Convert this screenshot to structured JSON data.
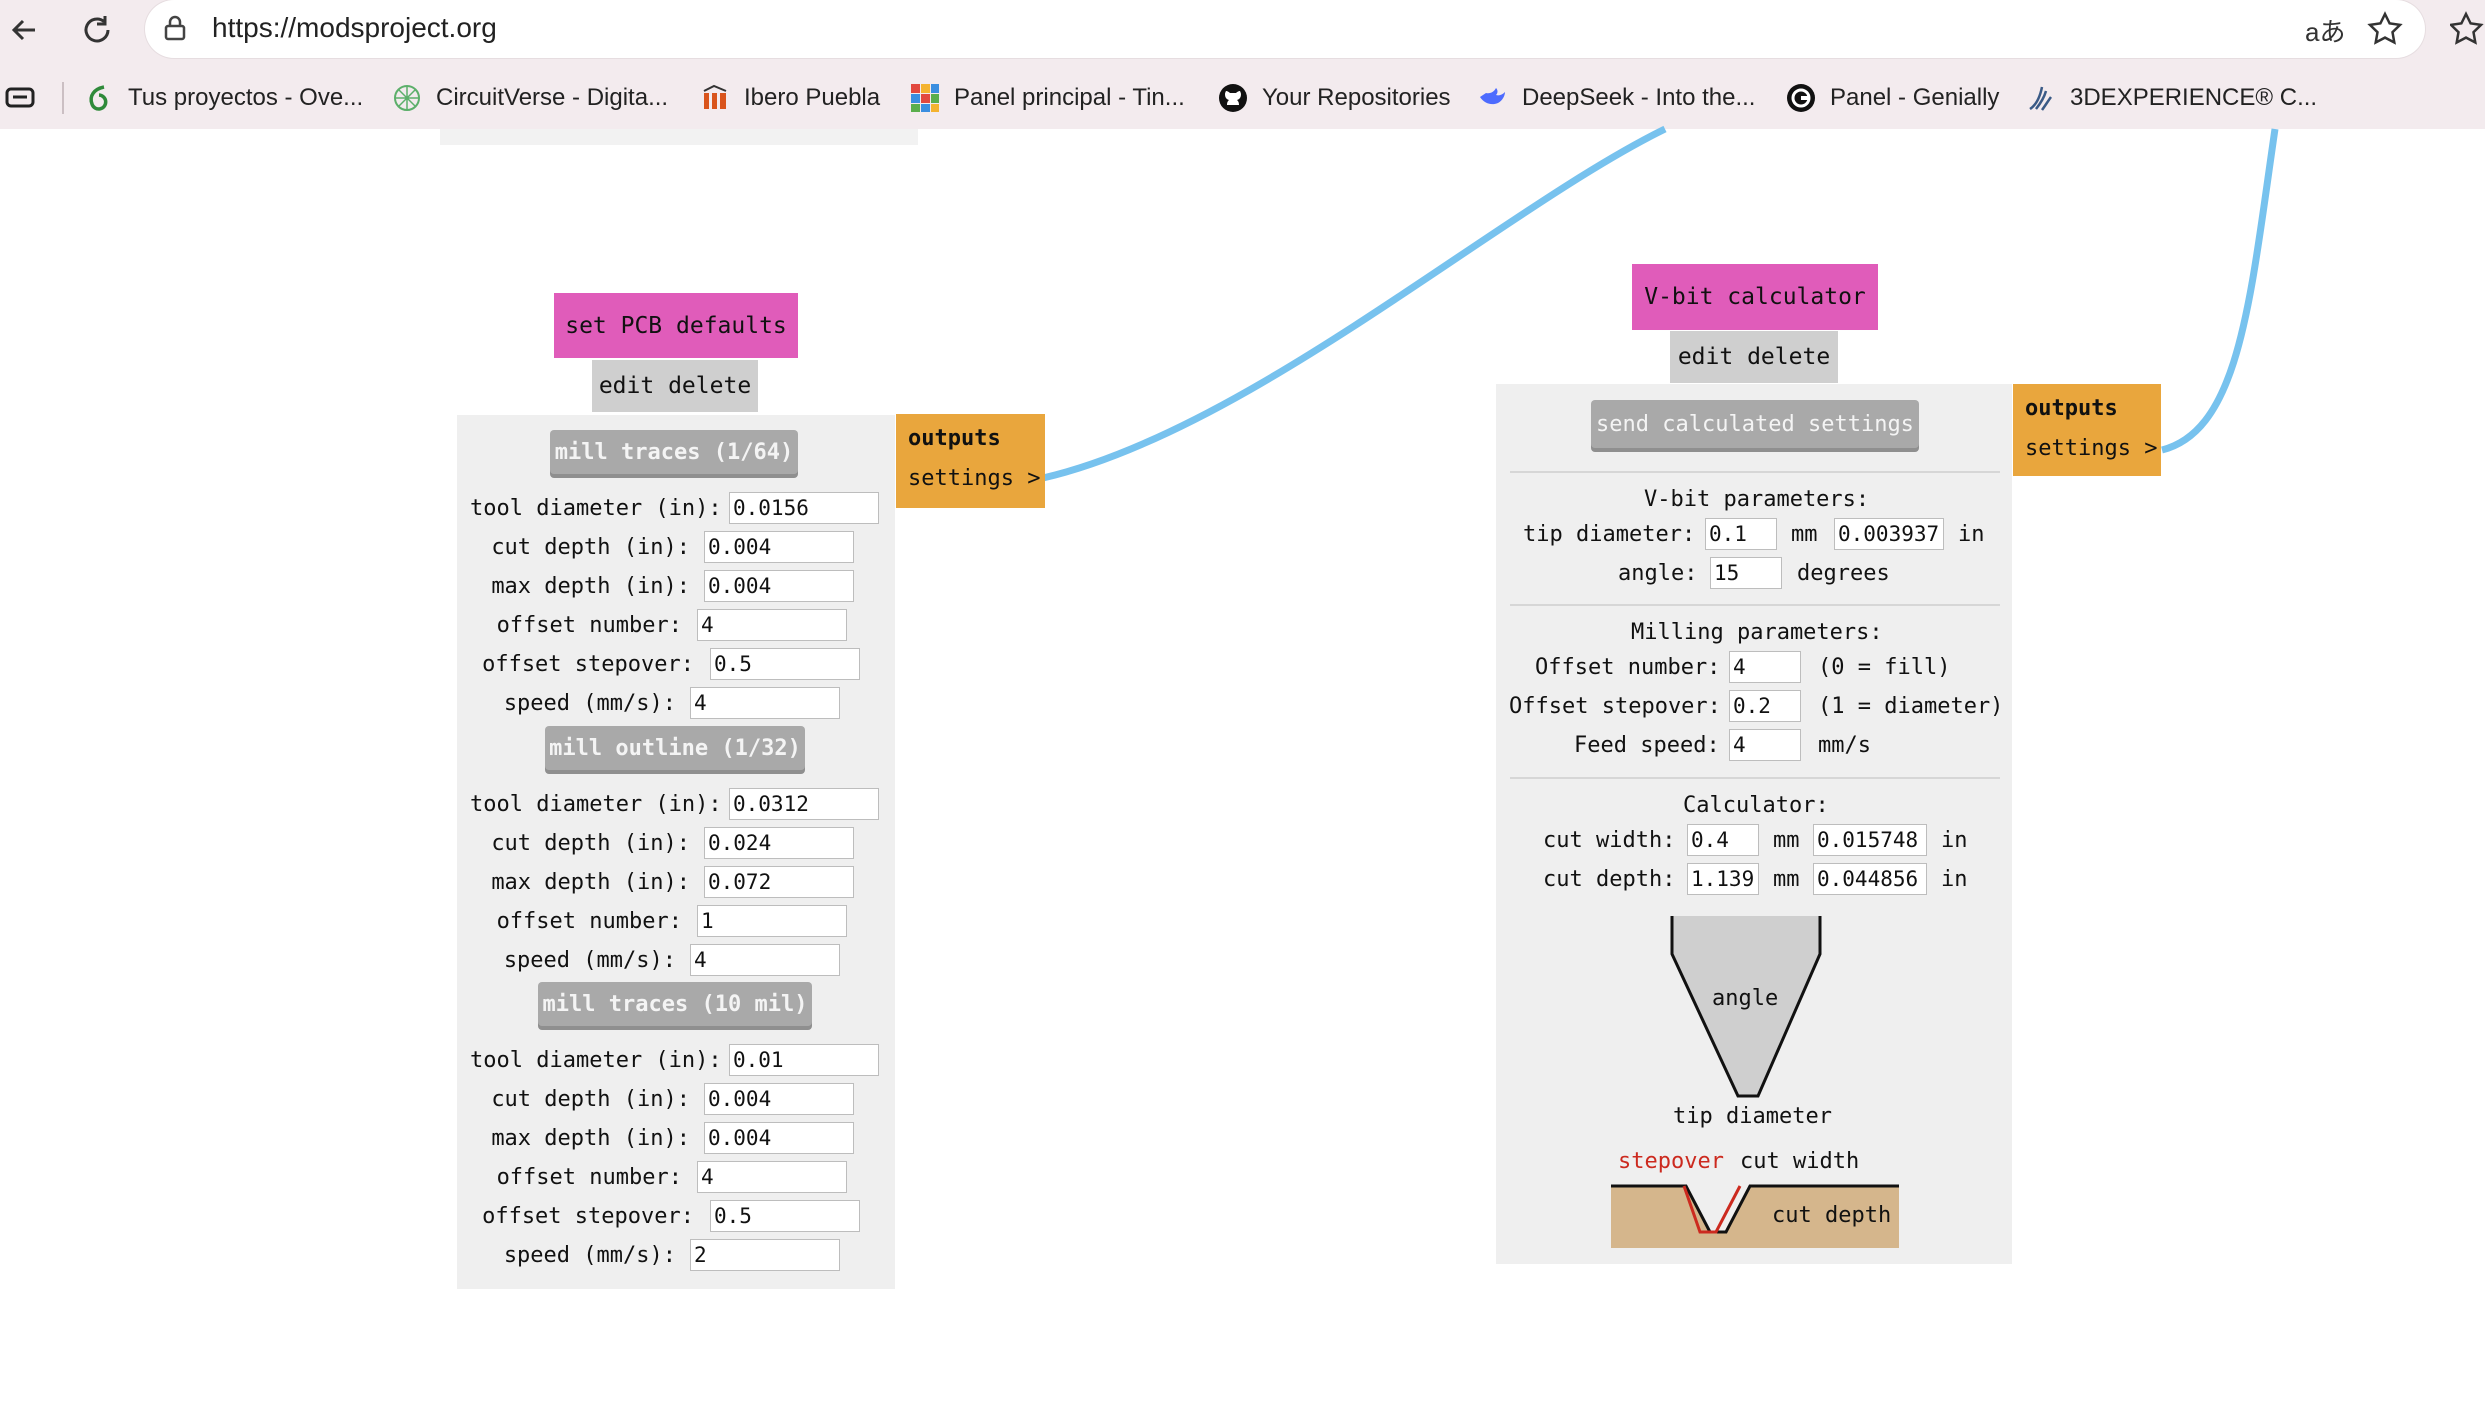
{
  "browser": {
    "url": "https://modsproject.org",
    "bookmarks": [
      {
        "label": "Tus proyectos - Ove...",
        "icon": "overleaf-icon"
      },
      {
        "label": "CircuitVerse - Digita...",
        "icon": "circuitverse-icon"
      },
      {
        "label": "Ibero Puebla",
        "icon": "ibero-icon"
      },
      {
        "label": "Panel principal - Tin...",
        "icon": "tinkercad-icon"
      },
      {
        "label": "Your Repositories",
        "icon": "github-icon"
      },
      {
        "label": "DeepSeek - Into the...",
        "icon": "deepseek-icon"
      },
      {
        "label": "Panel - Genially",
        "icon": "genially-icon"
      },
      {
        "label": "3DEXPERIENCE® C...",
        "icon": "3dexperience-icon"
      }
    ]
  },
  "pcb_module": {
    "title": "set PCB defaults",
    "edit": "edit",
    "delete": "delete",
    "outputs_title": "outputs",
    "output_settings": "settings >",
    "sections": [
      {
        "button": "mill traces (1/64)",
        "fields": [
          {
            "label": "tool diameter (in):",
            "value": "0.0156"
          },
          {
            "label": "cut depth (in):",
            "value": "0.004"
          },
          {
            "label": "max depth (in):",
            "value": "0.004"
          },
          {
            "label": "offset number:",
            "value": "4"
          },
          {
            "label": "offset stepover:",
            "value": "0.5"
          },
          {
            "label": "speed (mm/s):",
            "value": "4"
          }
        ]
      },
      {
        "button": "mill outline (1/32)",
        "fields": [
          {
            "label": "tool diameter (in):",
            "value": "0.0312"
          },
          {
            "label": "cut depth (in):",
            "value": "0.024"
          },
          {
            "label": "max depth (in):",
            "value": "0.072"
          },
          {
            "label": "offset number:",
            "value": "1"
          },
          {
            "label": "speed (mm/s):",
            "value": "4"
          }
        ]
      },
      {
        "button": "mill traces (10 mil)",
        "fields": [
          {
            "label": "tool diameter (in):",
            "value": "0.01"
          },
          {
            "label": "cut depth (in):",
            "value": "0.004"
          },
          {
            "label": "max depth (in):",
            "value": "0.004"
          },
          {
            "label": "offset number:",
            "value": "4"
          },
          {
            "label": "offset stepover:",
            "value": "0.5"
          },
          {
            "label": "speed (mm/s):",
            "value": "2"
          }
        ]
      }
    ]
  },
  "vbit_module": {
    "title": "V-bit calculator",
    "edit": "edit",
    "delete": "delete",
    "outputs_title": "outputs",
    "output_settings": "settings >",
    "send_button": "send calculated settings",
    "vbit_heading": "V-bit parameters:",
    "tip_diameter_label": "tip diameter:",
    "tip_diameter_mm": "0.1",
    "mm_unit": "mm",
    "tip_diameter_in": "0.003937",
    "in_unit": "in",
    "angle_label": "angle:",
    "angle_value": "15",
    "degrees_unit": "degrees",
    "milling_heading": "Milling parameters:",
    "offset_number_label": "Offset number:",
    "offset_number_value": "4",
    "offset_number_hint": "(0 = fill)",
    "offset_stepover_label": "Offset stepover:",
    "offset_stepover_value": "0.2",
    "offset_stepover_hint": "(1 = diameter)",
    "feed_speed_label": "Feed speed:",
    "feed_speed_value": "4",
    "feed_speed_unit": "mm/s",
    "calculator_heading": "Calculator:",
    "cut_width_label": "cut width:",
    "cut_width_mm": "0.4",
    "cut_width_in": "0.015748",
    "cut_depth_label": "cut depth:",
    "cut_depth_mm": "1.139",
    "cut_depth_in": "0.044856",
    "diagram_angle": "angle",
    "diagram_tip": "tip diameter",
    "diagram_stepover": "stepover",
    "diagram_cut_width": "cut width",
    "diagram_cut_depth": "cut depth"
  }
}
